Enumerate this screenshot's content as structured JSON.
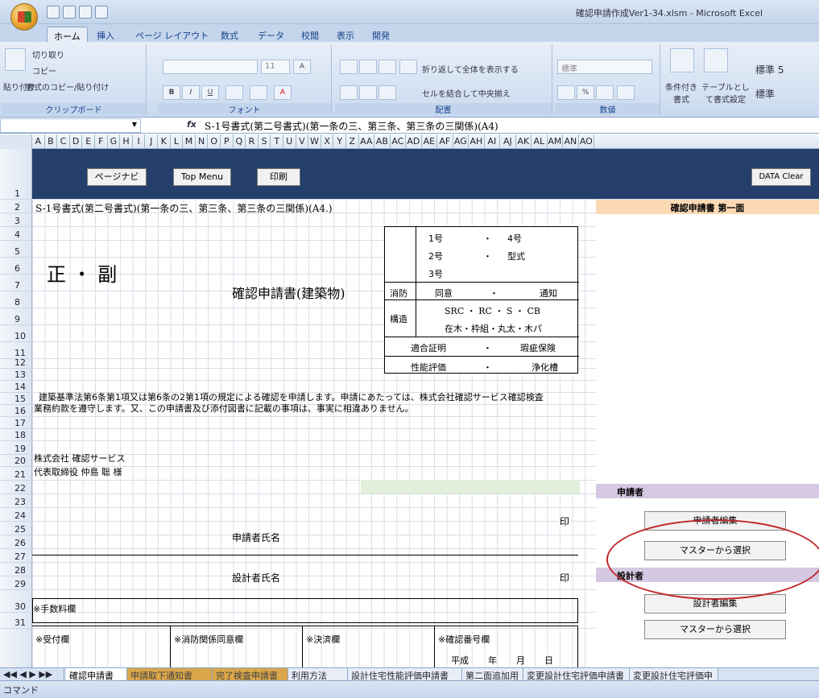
{
  "window": {
    "title": "確認申請作成Ver1-34.xlsm - Microsoft Excel"
  },
  "ribbon": {
    "tabs": [
      "ホーム",
      "挿入",
      "ページ レイアウト",
      "数式",
      "データ",
      "校閲",
      "表示",
      "開発"
    ],
    "clipboard": {
      "paste": "貼り付け",
      "cut": "切り取り",
      "copy": "コピー",
      "format_painter": "書式のコピー/貼り付け",
      "label": "クリップボード"
    },
    "font": {
      "size": "11",
      "label": "フォント",
      "bold": "B",
      "italic": "I",
      "underline": "U"
    },
    "alignment": {
      "wrap": "折り返して全体を表示する",
      "merge": "セルを結合して中央揃え",
      "label": "配置"
    },
    "number": {
      "format": "標準",
      "label": "数値",
      "percent": "%"
    },
    "styles": {
      "conditional": "条件付き書式",
      "table": "テーブルとして書式設定",
      "style1": "標準 5",
      "style2": "標準"
    }
  },
  "formula_bar": {
    "fx": "fx",
    "formula": "S-1号書式(第二号書式)(第一条の三、第三条、第三条の三関係)(A4)"
  },
  "columns": [
    "A",
    "B",
    "C",
    "D",
    "E",
    "F",
    "G",
    "H",
    "I",
    "J",
    "K",
    "L",
    "M",
    "N",
    "O",
    "P",
    "Q",
    "R",
    "S",
    "T",
    "U",
    "V",
    "W",
    "X",
    "Y",
    "Z",
    "AA",
    "AB",
    "AC",
    "AD",
    "AE",
    "AF",
    "AG",
    "AH",
    "AI",
    "AJ",
    "AK",
    "AL",
    "AM",
    "AN",
    "AO"
  ],
  "rows": [
    "1",
    "2",
    "3",
    "4",
    "5",
    "6",
    "7",
    "8",
    "9",
    "10",
    "11",
    "12",
    "13",
    "14",
    "15",
    "16",
    "17",
    "18",
    "19",
    "20",
    "21",
    "22",
    "23",
    "24",
    "25",
    "26",
    "27",
    "28",
    "29",
    "30",
    "31"
  ],
  "sheet": {
    "buttons": {
      "page_navi": "ページナビ",
      "top_menu": "Top Menu",
      "print": "印刷",
      "data_clear": "DATA Clear"
    },
    "heading": "S-1号書式(第二号書式)(第一条の三、第三条、第三条の三関係)(A4.)",
    "sei_fuku": "正 ・ 副",
    "doc_title": "確認申請書(建築物)",
    "table": {
      "r1a": "1号",
      "r1dot": "・",
      "r1b": "4号",
      "r2a": "2号",
      "r2dot": "・",
      "r2b": "型式",
      "r3a": "3号",
      "shobo": "消防",
      "doi": "同意",
      "dot3": "・",
      "tsuchi": "通知",
      "kozo": "構造",
      "src": "SRC ・ RC ・ S ・ CB",
      "wood": "在木・枠組・丸太・木パ",
      "tekigo": "適合証明",
      "dot5": "・",
      "kashi": "瑕疵保険",
      "seino": "性能評価",
      "dot6": "・",
      "joka": "浄化槽"
    },
    "statement1": "建築基準法第6条第1項又は第6条の2第1項の規定による確認を申請します。申請にあたっては、株式会社確認サービス確認検査",
    "statement2": "業務約款を遵守します。又、この申請書及び添付図書に記載の事項は、事実に相違ありません。",
    "company": "株式会社 確認サービス",
    "representative": "代表取締役 仲島 聡 様",
    "in1": "印",
    "applicant_name": "申請者氏名",
    "designer_name": "設計者氏名",
    "in2": "印",
    "fee": "※手数料欄",
    "reception": "※受付欄",
    "fire": "※消防関係同意欄",
    "settlement": "※決済欄",
    "confirm_no": "※確認番号欄",
    "heisei": "平成",
    "year": "年",
    "month": "月",
    "day": "日"
  },
  "right_panel": {
    "header": "確認申請書 第一面",
    "applicant_section": "申請者",
    "edit_applicant": "申請者編集",
    "master_select1": "マスターから選択",
    "designer_section": "設計者",
    "edit_designer": "設計者編集",
    "master_select2": "マスターから選択"
  },
  "sheet_tabs": [
    "確認申請書",
    "申請取下通知書",
    "完了検査申請書",
    "利用方法",
    "設計住宅性能評価申請書",
    "第二面追加用",
    "変更設計住宅評価申請書",
    "変更設計住宅評価申"
  ],
  "status": {
    "mode": "コマンド"
  },
  "colors": {
    "accent": "#243f6c",
    "section_bg": "#d5c8e2",
    "header_bg": "#fcd9b5",
    "highlight": "#c0282b"
  }
}
